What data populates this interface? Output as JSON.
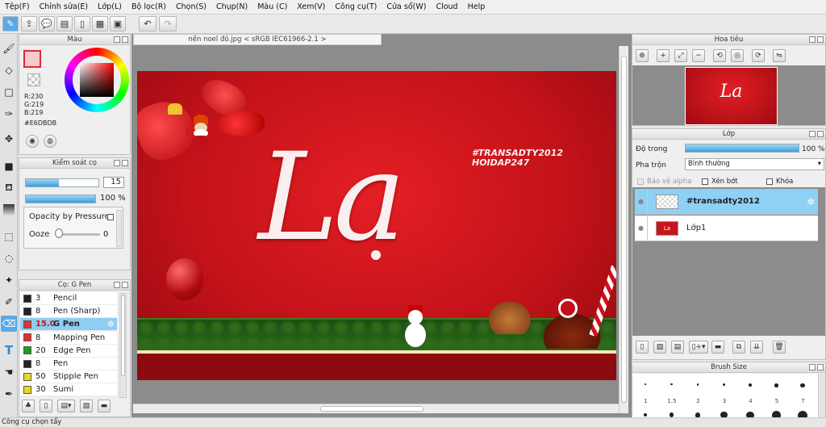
{
  "menu": [
    "Tệp(F)",
    "Chỉnh sửa(E)",
    "Lớp(L)",
    "Bộ lọc(R)",
    "Chọn(S)",
    "Chụp(N)",
    "Màu (C)",
    "Xem(V)",
    "Công cụ(T)",
    "Cửa sổ(W)",
    "Cloud",
    "Help"
  ],
  "icons": {
    "toolbar": [
      "pen-tablet-icon",
      "open-icon",
      "chat-icon",
      "comment-icon",
      "document-icon",
      "grid-icon",
      "undo-icon",
      "redo-icon"
    ],
    "tools": [
      "brush-icon",
      "eraser-icon",
      "rectangle-icon",
      "eyedropper-icon",
      "move-icon",
      "rect-fill-icon",
      "bucket-icon",
      "gradient-icon",
      "select-rect-icon",
      "lasso-icon",
      "magic-wand-icon",
      "select-pen-icon",
      "select-eraser-icon",
      "text-icon",
      "hand-icon",
      "pen-icon"
    ]
  },
  "color_panel": {
    "title": "Màu",
    "r": "R:230",
    "g": "G:219",
    "b": "B:219",
    "hex": "#E6DBDB",
    "fg_color": "#e0283a",
    "bg_color": "#ffffff"
  },
  "brush_control": {
    "title": "Kiểm soát cọ",
    "size": "15",
    "size_fill": 0.46,
    "opacity": "100 %",
    "opacity_fill": 1.0,
    "pressure_label": "Opacity by Pressure",
    "ooze_label": "Ooze",
    "ooze_value": "0",
    "ooze_level": 0
  },
  "brush_list": {
    "title": "Cọ: G Pen",
    "items": [
      {
        "size": "3",
        "name": "Pencil",
        "color": "#222222"
      },
      {
        "size": "8",
        "name": "Pen (Sharp)",
        "color": "#222222"
      },
      {
        "size": "15.0",
        "name": "G Pen",
        "color": "#e53030"
      },
      {
        "size": "8",
        "name": "Mapping Pen",
        "color": "#e53030"
      },
      {
        "size": "20",
        "name": "Edge Pen",
        "color": "#18a018"
      },
      {
        "size": "8",
        "name": "Pen",
        "color": "#222222"
      },
      {
        "size": "50",
        "name": "Stipple Pen",
        "color": "#e8d820"
      },
      {
        "size": "30",
        "name": "Sumi",
        "color": "#e8d820"
      }
    ],
    "selected_index": 2
  },
  "document": {
    "tab": "nền noel đỏ.jpg < sRGB IEC61966-2.1 >",
    "main_text": "La",
    "tag_line1": "#TRANSADTY2012",
    "tag_line2": "HOIDAP247"
  },
  "navigator": {
    "title": "Hoa tiêu",
    "thumb_text": "La"
  },
  "layers": {
    "title": "Lớp",
    "opacity_label": "Độ trong",
    "opacity_value": "100 %",
    "opacity_fill": 1.0,
    "blend_label": "Pha trộn",
    "blend_value": "Bình thường",
    "protect_alpha": "Bảo vệ alpha",
    "clip": "Xén bớt",
    "lock": "Khóa",
    "items": [
      {
        "name": "#transadty2012",
        "selected": true
      },
      {
        "name": "Lớp1",
        "selected": false
      }
    ]
  },
  "brush_size": {
    "title": "Brush Size",
    "sizes": [
      "1",
      "1.5",
      "2",
      "3",
      "4",
      "5",
      "7"
    ]
  },
  "status": "Công cụ chọn tẩy",
  "colors": {
    "accent": "#5aa9e6",
    "selected_row": "#8fcdf2",
    "layer_selected": "#8fd0f5"
  }
}
